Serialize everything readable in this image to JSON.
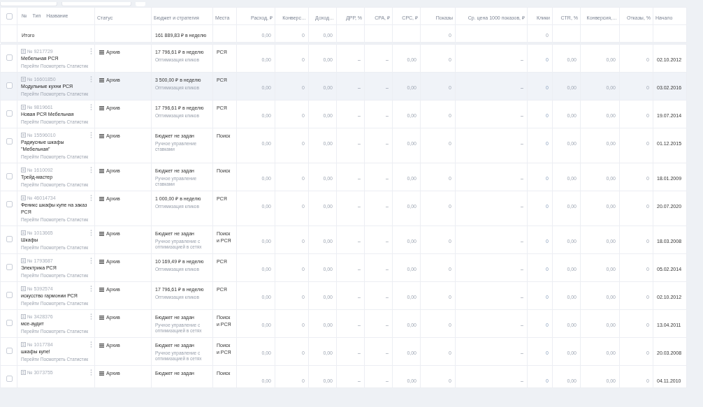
{
  "all_checked": false,
  "columns": [
    "№",
    "Тип",
    "Название",
    "Статус",
    "Бюджет и стратегия",
    "Места",
    "Расход, ₽",
    "Конверс…",
    "Доход…",
    "ДРР, %",
    "CPA, ₽",
    "CPC, ₽",
    "Показы",
    "Ср. цена 1000 показов, ₽",
    "Клики",
    "CTR, %",
    "Конверсия,…",
    "Отказы, %",
    "Начало"
  ],
  "totals": {
    "label": "Итого",
    "budget": "161 889,83 ₽ в неделю",
    "cells": [
      "0,00",
      "0",
      "0,00",
      null,
      null,
      null,
      "0",
      null,
      "0",
      null,
      null,
      null
    ]
  },
  "rows": [
    {
      "id": "№ 9217729",
      "name": "Мебельная РСЯ",
      "links": [
        "Перейти",
        "Посмотреть",
        "Статистик"
      ],
      "status": "Архив",
      "budget": "17 796,61 ₽ в неделю",
      "strategy": "Оптимизация кликов",
      "places": "РСЯ",
      "cells": [
        "0,00",
        "0",
        "0,00",
        "–",
        "–",
        "0,00",
        "0",
        "–",
        "0",
        "0,00",
        "0,00",
        "0"
      ],
      "start": "02.10.2012",
      "highlighted": false,
      "checked": false
    },
    {
      "id": "№ 16601850",
      "name": "Модульные кухни РСЯ",
      "links": [
        "Перейти",
        "Посмотреть",
        "Статистик"
      ],
      "status": "Архив",
      "budget": "3 500,00 ₽ в неделю",
      "strategy": "Оптимизация кликов",
      "places": "РСЯ",
      "cells": [
        "0,00",
        "0",
        "0,00",
        "–",
        "–",
        "0,00",
        "0",
        "–",
        "0",
        "0,00",
        "0,00",
        "0"
      ],
      "start": "03.02.2016",
      "highlighted": true,
      "checked": false
    },
    {
      "id": "№ 9819661",
      "name": "Новая РСЯ Мебельная",
      "links": [
        "Перейти",
        "Посмотреть",
        "Статистик"
      ],
      "status": "Архив",
      "budget": "17 796,61 ₽ в неделю",
      "strategy": "Оптимизация кликов",
      "places": "РСЯ",
      "cells": [
        "0,00",
        "0",
        "0,00",
        "–",
        "–",
        "0,00",
        "0",
        "–",
        "0",
        "0,00",
        "0,00",
        "0"
      ],
      "start": "19.07.2014",
      "highlighted": false,
      "checked": false
    },
    {
      "id": "№ 15596010",
      "name": "Радиусные шкафы \"Мебельная\"",
      "links": [
        "Перейти",
        "Посмотреть",
        "Статистик"
      ],
      "status": "Архив",
      "budget": "Бюджет не задан",
      "strategy": "Ручное управление ставками",
      "places": "Поиск",
      "cells": [
        "0,00",
        "0",
        "0,00",
        "–",
        "–",
        "0,00",
        "0",
        "–",
        "0",
        "0,00",
        "0,00",
        "0"
      ],
      "start": "01.12.2015",
      "highlighted": false,
      "checked": false
    },
    {
      "id": "№ 1610092",
      "name": "Трейд-мастер",
      "links": [
        "Перейти",
        "Посмотреть",
        "Статистик"
      ],
      "status": "Архив",
      "budget": "Бюджет не задан",
      "strategy": "Ручное управление ставками",
      "places": "Поиск",
      "cells": [
        "0,00",
        "0",
        "0,00",
        "–",
        "–",
        "0,00",
        "0",
        "–",
        "0",
        "0,00",
        "0,00",
        "0"
      ],
      "start": "18.01.2009",
      "highlighted": false,
      "checked": false
    },
    {
      "id": "№ 46014734",
      "name": "Феникс шкафы купе на заказ РСЯ",
      "links": [
        "Перейти",
        "Посмотреть",
        "Статистик"
      ],
      "status": "Архив",
      "budget": "1 000,00 ₽ в неделю",
      "strategy": "Оптимизация кликов",
      "places": "РСЯ",
      "cells": [
        "0,00",
        "0",
        "0,00",
        "–",
        "–",
        "0,00",
        "0",
        "–",
        "0",
        "0,00",
        "0,00",
        "0"
      ],
      "start": "20.07.2020",
      "highlighted": false,
      "checked": false
    },
    {
      "id": "№ 1013665",
      "name": "Шкафы",
      "links": [
        "Перейти",
        "Посмотреть",
        "Статистик"
      ],
      "status": "Архив",
      "budget": "Бюджет не задан",
      "strategy": "Ручное управление с оптимизацией в сетях",
      "places": "Поиск и РСЯ",
      "cells": [
        "0,00",
        "0",
        "0,00",
        "–",
        "–",
        "0,00",
        "0",
        "–",
        "0",
        "0,00",
        "0,00",
        "0"
      ],
      "start": "18.03.2008",
      "highlighted": false,
      "checked": false
    },
    {
      "id": "№ 1793687",
      "name": "Электрика РСЯ",
      "links": [
        "Перейти",
        "Посмотреть",
        "Статистик"
      ],
      "status": "Архив",
      "budget": "10 169,49 ₽ в неделю",
      "strategy": "Оптимизация кликов",
      "places": "РСЯ",
      "cells": [
        "0,00",
        "0",
        "0,00",
        "–",
        "–",
        "0,00",
        "0",
        "–",
        "0",
        "0,00",
        "0,00",
        "0"
      ],
      "start": "05.02.2014",
      "highlighted": false,
      "checked": false
    },
    {
      "id": "№ 5392574",
      "name": "искусство гармонии РСЯ",
      "links": [
        "Перейти",
        "Посмотреть",
        "Статистик"
      ],
      "status": "Архив",
      "budget": "17 796,61 ₽ в неделю",
      "strategy": "Оптимизация кликов",
      "places": "РСЯ",
      "cells": [
        "0,00",
        "0",
        "0,00",
        "–",
        "–",
        "0,00",
        "0",
        "–",
        "0",
        "0,00",
        "0,00",
        "0"
      ],
      "start": "02.10.2012",
      "highlighted": false,
      "checked": false
    },
    {
      "id": "№ 3428376",
      "name": "мсе-аудит",
      "links": [
        "Перейти",
        "Посмотреть",
        "Статистик"
      ],
      "status": "Архив",
      "budget": "Бюджет не задан",
      "strategy": "Ручное управление с оптимизацией в сетях",
      "places": "Поиск и РСЯ",
      "cells": [
        "0,00",
        "0",
        "0,00",
        "–",
        "–",
        "0,00",
        "0",
        "–",
        "0",
        "0,00",
        "0,00",
        "0"
      ],
      "start": "13.04.2011",
      "highlighted": false,
      "checked": false
    },
    {
      "id": "№ 1017784",
      "name": "шкафы купе!",
      "links": [
        "Перейти",
        "Посмотреть",
        "Статистик"
      ],
      "status": "Архив",
      "budget": "Бюджет не задан",
      "strategy": "Ручное управление с оптимизацией в сетях",
      "places": "Поиск и РСЯ",
      "cells": [
        "0,00",
        "0",
        "0,00",
        "–",
        "–",
        "0,00",
        "0",
        "–",
        "0",
        "0,00",
        "0,00",
        "0"
      ],
      "start": "20.03.2008",
      "highlighted": false,
      "checked": false
    },
    {
      "id": "№ 3073755",
      "status": "Архив",
      "budget": "Бюджет не задан",
      "places": "Поиск",
      "cells": [
        "0,00",
        "0",
        "0,00",
        "–",
        "–",
        "0,00",
        "0",
        "–",
        "0",
        "0,00",
        "0,00",
        "0"
      ],
      "start": "04.11.2010",
      "highlighted": false,
      "checked": false
    }
  ]
}
